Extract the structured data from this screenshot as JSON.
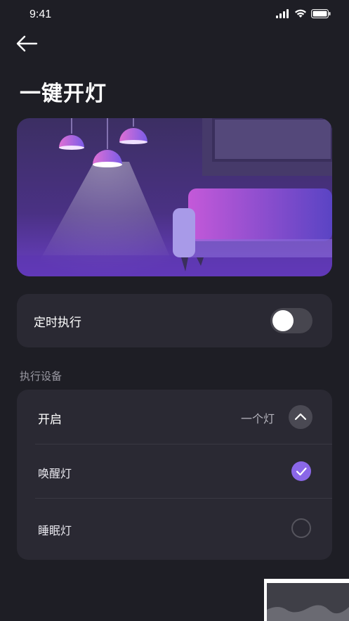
{
  "status_bar": {
    "time": "9:41"
  },
  "header": {
    "title": "一键开灯"
  },
  "timer": {
    "label": "定时执行",
    "enabled": false
  },
  "devices": {
    "section_label": "执行设备",
    "group": {
      "label": "开启",
      "summary": "一个灯",
      "expanded": true
    },
    "items": [
      {
        "label": "唤醒灯",
        "selected": true
      },
      {
        "label": "睡眠灯",
        "selected": false
      }
    ]
  },
  "colors": {
    "accent": "#8a67e8",
    "background": "#1e1e25",
    "card": "#2a2933"
  }
}
